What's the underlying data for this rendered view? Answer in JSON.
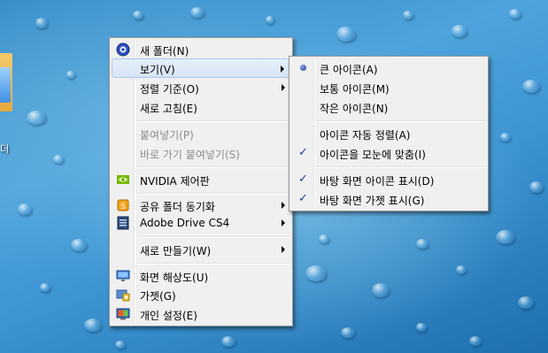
{
  "desktop": {
    "icon_label": "더"
  },
  "main_menu": {
    "items": [
      {
        "label": "새 폴더(N)",
        "icon": "new-folder-icon"
      },
      {
        "label": "보기(V)",
        "submenu": true
      },
      {
        "label": "정렬 기준(O)",
        "submenu": true
      },
      {
        "label": "새로 고침(E)"
      },
      {
        "label": "붙여넣기(P)",
        "disabled": true
      },
      {
        "label": "바로 가기 붙여넣기(S)",
        "disabled": true
      },
      {
        "label": "NVIDIA 제어판",
        "icon": "nvidia-icon"
      },
      {
        "label": "공유 폴더 동기화",
        "icon": "sync-icon",
        "submenu": true
      },
      {
        "label": "Adobe Drive CS4",
        "icon": "adobe-drive-icon",
        "submenu": true
      },
      {
        "label": "새로 만들기(W)",
        "submenu": true
      },
      {
        "label": "화면 해상도(U)",
        "icon": "display-icon"
      },
      {
        "label": "가젯(G)",
        "icon": "gadget-icon"
      },
      {
        "label": "개인 설정(E)",
        "icon": "personalize-icon"
      }
    ]
  },
  "view_submenu": {
    "items": [
      {
        "label": "큰 아이콘(A)",
        "marker": "bullet"
      },
      {
        "label": "보통 아이콘(M)"
      },
      {
        "label": "작은 아이콘(N)"
      },
      {
        "label": "아이콘 자동 정렬(A)"
      },
      {
        "label": "아이콘을 모눈에 맞춤(I)",
        "marker": "check"
      },
      {
        "label": "바탕 화면 아이콘 표시(D)",
        "marker": "check"
      },
      {
        "label": "바탕 화면 가젯 표시(G)",
        "marker": "check"
      }
    ],
    "check_glyph": "✓"
  },
  "colors": {
    "menu_bg": "#f0f0f0",
    "highlight": "#d6e5f7",
    "disabled_text": "#8d8d8d",
    "desktop_blue": "#3c93d0"
  }
}
